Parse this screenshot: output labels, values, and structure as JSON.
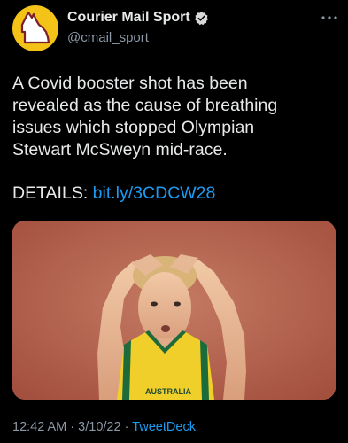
{
  "author": {
    "name": "Courier Mail Sport",
    "handle": "@cmail_sport",
    "avatar_icon": "queensland-map-icon",
    "verified_icon": "verified-badge-icon",
    "more_icon": "more-options-icon"
  },
  "tweet": {
    "lines": [
      "A Covid booster shot has been",
      "revealed as the cause of breathing",
      "issues which stopped Olympian",
      "Stewart McSweyn mid-race."
    ],
    "details_label": "DETAILS:",
    "link": "bit.ly/3CDCW28"
  },
  "media": {
    "jersey_text": "AUSTRALIA"
  },
  "meta": {
    "time": "12:42 AM",
    "separator": "·",
    "date": "3/10/22",
    "source": "TweetDeck"
  },
  "colors": {
    "background": "#000000",
    "text": "#e7e9ea",
    "secondary": "#8b98a5",
    "link": "#1d9bf0",
    "avatar": "#f4c318"
  }
}
